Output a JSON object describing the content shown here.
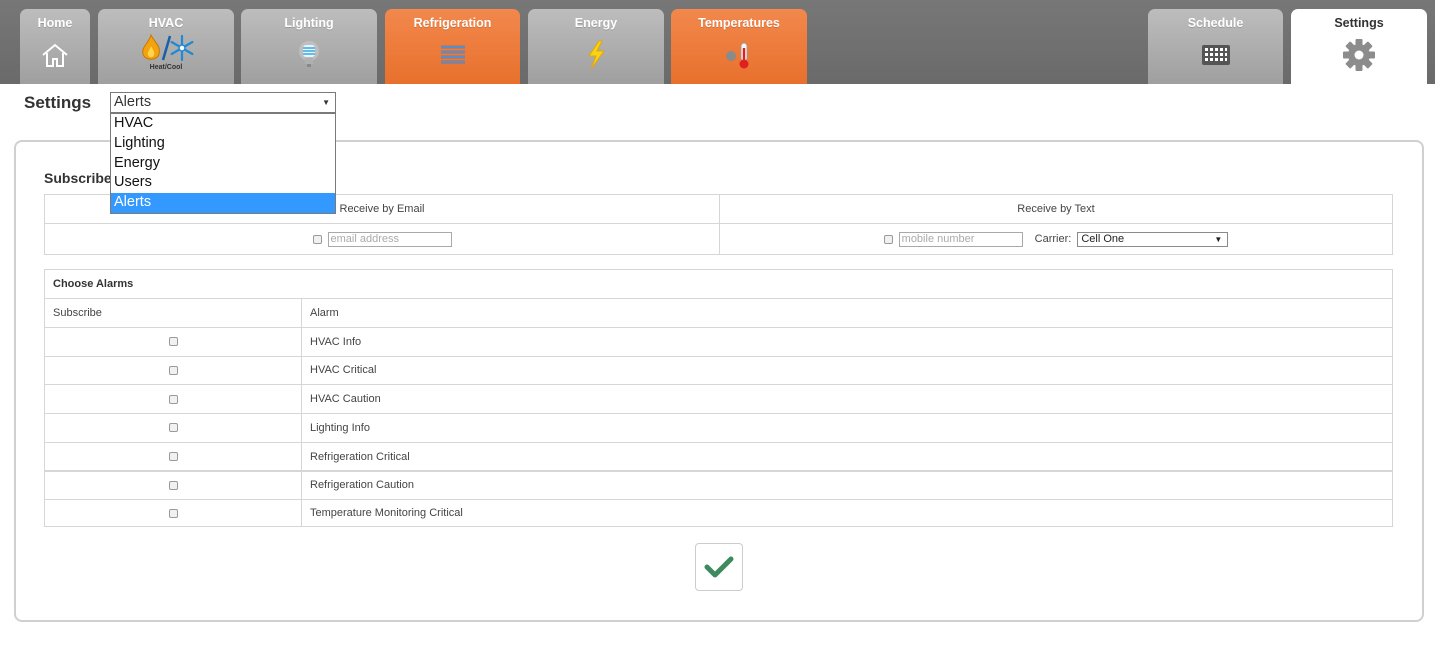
{
  "nav": {
    "tabs": [
      {
        "label": "Home",
        "icon": "house-icon"
      },
      {
        "label": "HVAC",
        "icon": "heat-cool-icon",
        "sublabel": "Heat/Cool"
      },
      {
        "label": "Lighting",
        "icon": "light-bulb-icon"
      },
      {
        "label": "Refrigeration",
        "icon": "refrigeration-coil-icon"
      },
      {
        "label": "Energy",
        "icon": "lightning-bolt-icon"
      },
      {
        "label": "Temperatures",
        "icon": "thermometer-icon"
      },
      {
        "label": "Schedule",
        "icon": "calendar-grid-icon"
      },
      {
        "label": "Settings",
        "icon": "gear-icon"
      }
    ],
    "colors": {
      "gray_tab": "#a9a9a9",
      "orange_tab": "#ec7a3a",
      "active_tab": "#ffffff",
      "bar": "#707070"
    }
  },
  "settings": {
    "title": "Settings",
    "selected": "Alerts",
    "options": [
      "HVAC",
      "Lighting",
      "Energy",
      "Users",
      "Alerts"
    ]
  },
  "subscribe": {
    "heading": "Subscribe",
    "email_header": "Receive by Email",
    "text_header": "Receive by Text",
    "email_placeholder": "email address",
    "mobile_placeholder": "mobile number",
    "carrier_label": "Carrier:",
    "carrier_value": "Cell One"
  },
  "alarms": {
    "heading": "Choose Alarms",
    "col_subscribe": "Subscribe",
    "col_alarm": "Alarm",
    "rows": [
      "HVAC Info",
      "HVAC Critical",
      "HVAC Caution",
      "Lighting Info",
      "Refrigeration Critical",
      "Refrigeration Caution",
      "Temperature Monitoring Critical"
    ]
  },
  "confirm": {
    "icon": "checkmark-icon",
    "color": "#3d8a5e"
  }
}
